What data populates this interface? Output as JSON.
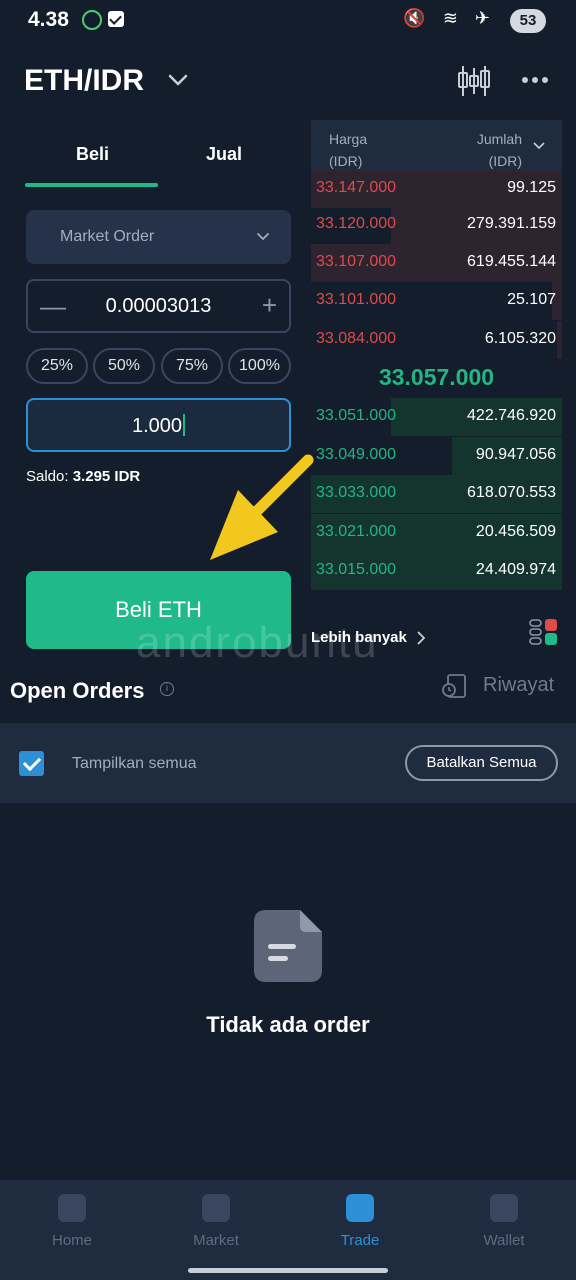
{
  "status_bar": {
    "time": "4.38",
    "battery": "53",
    "icons": [
      "app-icon",
      "check-icon",
      "mute-icon",
      "wifi-icon",
      "airplane-icon"
    ]
  },
  "header": {
    "pair": "ETH/IDR",
    "icons": [
      "chevron-down-icon",
      "candlestick-icon",
      "more-icon"
    ]
  },
  "tabs": [
    {
      "label": "Beli",
      "active": true
    },
    {
      "label": "Jual",
      "active": false
    }
  ],
  "order_form": {
    "order_type": "Market Order",
    "quantity": "0.00003013",
    "percent_options": [
      "25%",
      "50%",
      "75%",
      "100%"
    ],
    "total": "1.000",
    "saldo_label": "Saldo:",
    "saldo_value": "3.295 IDR",
    "submit_label": "Beli ETH"
  },
  "order_book": {
    "price_header": "Harga",
    "price_unit": "(IDR)",
    "amount_header": "Jumlah",
    "amount_unit": "(IDR)",
    "asks": [
      {
        "price": "33.147.000",
        "amount": "99.125"
      },
      {
        "price": "33.120.000",
        "amount": "279.391.159"
      },
      {
        "price": "33.107.000",
        "amount": "619.455.144"
      },
      {
        "price": "33.101.000",
        "amount": "25.107"
      },
      {
        "price": "33.084.000",
        "amount": "6.105.320"
      }
    ],
    "last_price": "33.057.000",
    "bids": [
      {
        "price": "33.051.000",
        "amount": "422.746.920"
      },
      {
        "price": "33.049.000",
        "amount": "90.947.056"
      },
      {
        "price": "33.033.000",
        "amount": "618.070.553"
      },
      {
        "price": "33.021.000",
        "amount": "20.456.509"
      },
      {
        "price": "33.015.000",
        "amount": "24.409.974"
      }
    ],
    "more_link": "Lebih banyak"
  },
  "watermark": "androbuntu",
  "open_orders": {
    "title": "Open Orders",
    "history_label": "Riwayat",
    "show_all_label": "Tampilkan semua",
    "cancel_all_label": "Batalkan Semua",
    "empty_message": "Tidak ada order"
  },
  "bottom_nav": [
    {
      "label": "Home",
      "icon": "home-icon",
      "active": false
    },
    {
      "label": "Market",
      "icon": "market-icon",
      "active": false
    },
    {
      "label": "Trade",
      "icon": "trade-icon",
      "active": true
    },
    {
      "label": "Wallet",
      "icon": "wallet-icon",
      "active": false
    }
  ],
  "colors": {
    "background": "#141d2b",
    "accent_green": "#1fb98a",
    "ask_red": "#e04a4a",
    "active_blue": "#2d8fd6"
  }
}
